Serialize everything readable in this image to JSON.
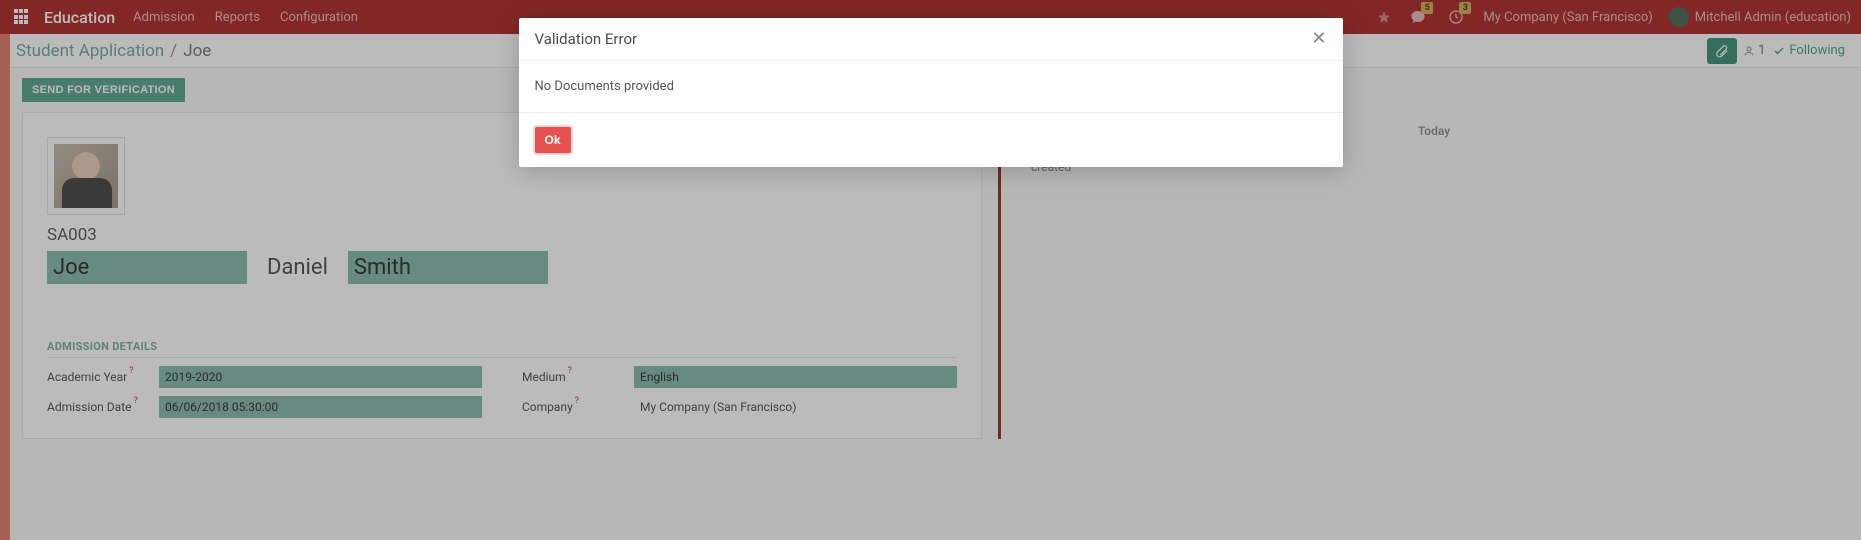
{
  "topbar": {
    "brand": "Education",
    "menu": [
      "Admission",
      "Reports",
      "Configuration"
    ],
    "chat_badge": "5",
    "clock_badge": "3",
    "company": "My Company (San Francisco)",
    "user": "Mitchell Admin (education)"
  },
  "breadcrumb": {
    "root": "Student Application",
    "current": "Joe"
  },
  "subbar": {
    "follower_count": "1",
    "following_label": "Following"
  },
  "actions": {
    "send_verify": "SEND FOR VERIFICATION"
  },
  "record": {
    "ref": "SA003",
    "first_name": "Joe",
    "middle_name": "Daniel",
    "last_name": "Smith",
    "section_admission": "ADMISSION DETAILS",
    "labels": {
      "academic_year": "Academic Year",
      "admission_date": "Admission Date",
      "medium": "Medium",
      "company": "Company"
    },
    "values": {
      "academic_year": "2019-2020",
      "admission_date": "06/06/2018 05:30:00",
      "medium": "English",
      "company": "My Company (San Francisco)"
    }
  },
  "chatter": {
    "today": "Today",
    "log": "created"
  },
  "modal": {
    "title": "Validation Error",
    "body": "No Documents provided",
    "ok": "Ok"
  }
}
